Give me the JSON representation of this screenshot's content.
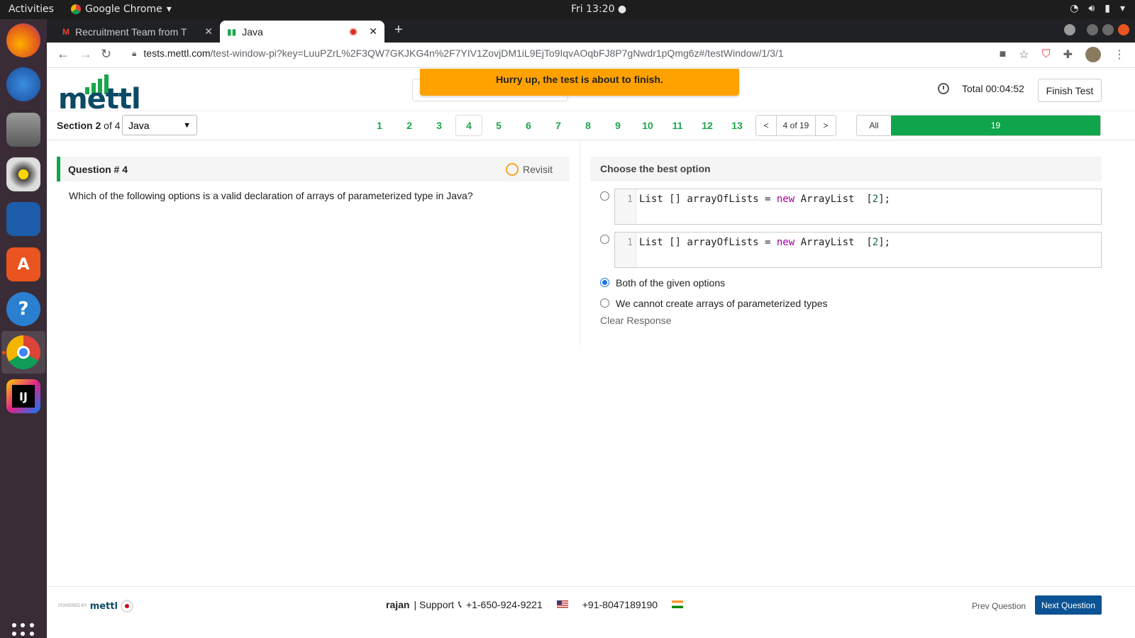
{
  "os": {
    "activities": "Activities",
    "app_name": "Google Chrome",
    "clock": "Fri 13:20 ●"
  },
  "browser": {
    "tabs": [
      {
        "title": "Recruitment Team from T",
        "active": false
      },
      {
        "title": "Java",
        "active": true
      }
    ],
    "url_host": "tests.mettl.com",
    "url_path": "/test-window-pi?key=LuuPZrL%2F3QW7GKJKG4n%2F7YIV1ZovjDM1iL9EjTo9IqvAOqbFJ8P7gNwdr1pQmg6z#/testWindow/1/3/1"
  },
  "header": {
    "logo_text": "mettl",
    "banner": "Hurry up, the test is about to finish.",
    "timer_label": "Total 00:04:52",
    "finish_button": "Finish Test"
  },
  "section": {
    "prefix": "Section",
    "number": "2",
    "of_text": "of 4",
    "selected": "Java",
    "question_numbers": [
      "1",
      "2",
      "3",
      "4",
      "5",
      "6",
      "7",
      "8",
      "9",
      "10",
      "11",
      "12",
      "13"
    ],
    "current_question": "4",
    "pager_prev": "<",
    "pager_count": "4 of 19",
    "pager_next": ">",
    "filter_all": "All",
    "filter_count": "19"
  },
  "question": {
    "title": "Question # 4",
    "revisit": "Revisit",
    "text": "Which of the following options is a valid declaration of arrays of parameterized type in Java?"
  },
  "answers": {
    "header": "Choose the best option",
    "code_options": [
      {
        "line": "1",
        "code_a": "List [] arrayOfLists = ",
        "keyword": "new",
        "code_b": " ArrayList  [",
        "number": "2",
        "code_c": "];"
      },
      {
        "line": "1",
        "code_a": "List [] arrayOfLists = ",
        "keyword": "new",
        "code_b": " ArrayList  [",
        "number": "2",
        "code_c": "];"
      }
    ],
    "text_options": [
      {
        "label": "Both of the given options",
        "selected": true
      },
      {
        "label": "We cannot create arrays of parameterized types",
        "selected": false
      }
    ],
    "clear": "Clear Response"
  },
  "footer": {
    "powered_by": "POWERED BY",
    "powered_logo": "mettl",
    "user": "rajan",
    "support": "| Support",
    "phone_us": "+1-650-924-9221",
    "phone_in": "+91-8047189190",
    "prev_question": "Prev Question",
    "next_question": "Next Question"
  },
  "colors": {
    "accent_green": "#0fa54b",
    "banner_orange": "#ffa200",
    "next_blue": "#0b5394"
  }
}
